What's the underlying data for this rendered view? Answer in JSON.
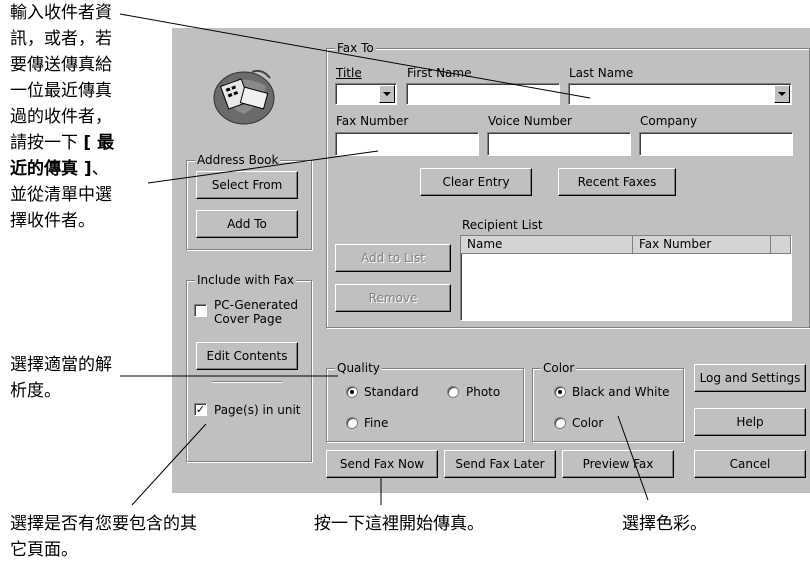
{
  "fax_to": {
    "group_title": "Fax To",
    "title_label": "Title",
    "first_name_label": "First Name",
    "last_name_label": "Last Name",
    "fax_number_label": "Fax Number",
    "voice_number_label": "Voice Number",
    "company_label": "Company",
    "title_value": "",
    "first_name_value": "",
    "last_name_value": "",
    "fax_number_value": "",
    "voice_number_value": "",
    "company_value": ""
  },
  "buttons": {
    "clear_entry": "Clear Entry",
    "recent_faxes": "Recent Faxes",
    "add_to_list": "Add to List",
    "remove": "Remove",
    "log_settings": "Log and Settings",
    "help": "Help",
    "cancel": "Cancel",
    "send_now": "Send Fax Now",
    "send_later": "Send Fax Later",
    "preview": "Preview Fax"
  },
  "recipient_list": {
    "label": "Recipient List",
    "columns": [
      "Name",
      "Fax Number"
    ]
  },
  "address_book": {
    "group_title": "Address Book",
    "select_from": "Select From",
    "add_to": "Add To"
  },
  "include": {
    "group_title": "Include with Fax",
    "cover_page_line1": "PC-Generated",
    "cover_page_line2": "Cover Page",
    "cover_checked": false,
    "edit_contents": "Edit Contents",
    "pages_in_unit": "Page(s) in unit",
    "pages_checked": true
  },
  "quality": {
    "group_title": "Quality",
    "standard": "Standard",
    "photo": "Photo",
    "fine": "Fine",
    "selected": "Standard"
  },
  "color": {
    "group_title": "Color",
    "bw": "Black and White",
    "color": "Color",
    "selected": "Black and White"
  },
  "annotations": {
    "a1_l1": "輸入收件者資",
    "a1_l2": "訊，或者，若",
    "a1_l3": "要傳送傳真給",
    "a1_l4": "一位最近傳真",
    "a1_l5": "過的收件者，",
    "a1_l6a": "請按一下 ",
    "a1_l6b": "[ 最",
    "a1_l7a": "近的傳真 ]",
    "a1_l7b": "、",
    "a1_l8": "並從清單中選",
    "a1_l9": "擇收件者。",
    "a2_l1": "選擇適當的解",
    "a2_l2": "析度。",
    "a3_l1": "選擇是否有您要包含的其",
    "a3_l2": "它頁面。",
    "a4": "按一下這裡開始傳真。",
    "a5": "選擇色彩。"
  }
}
